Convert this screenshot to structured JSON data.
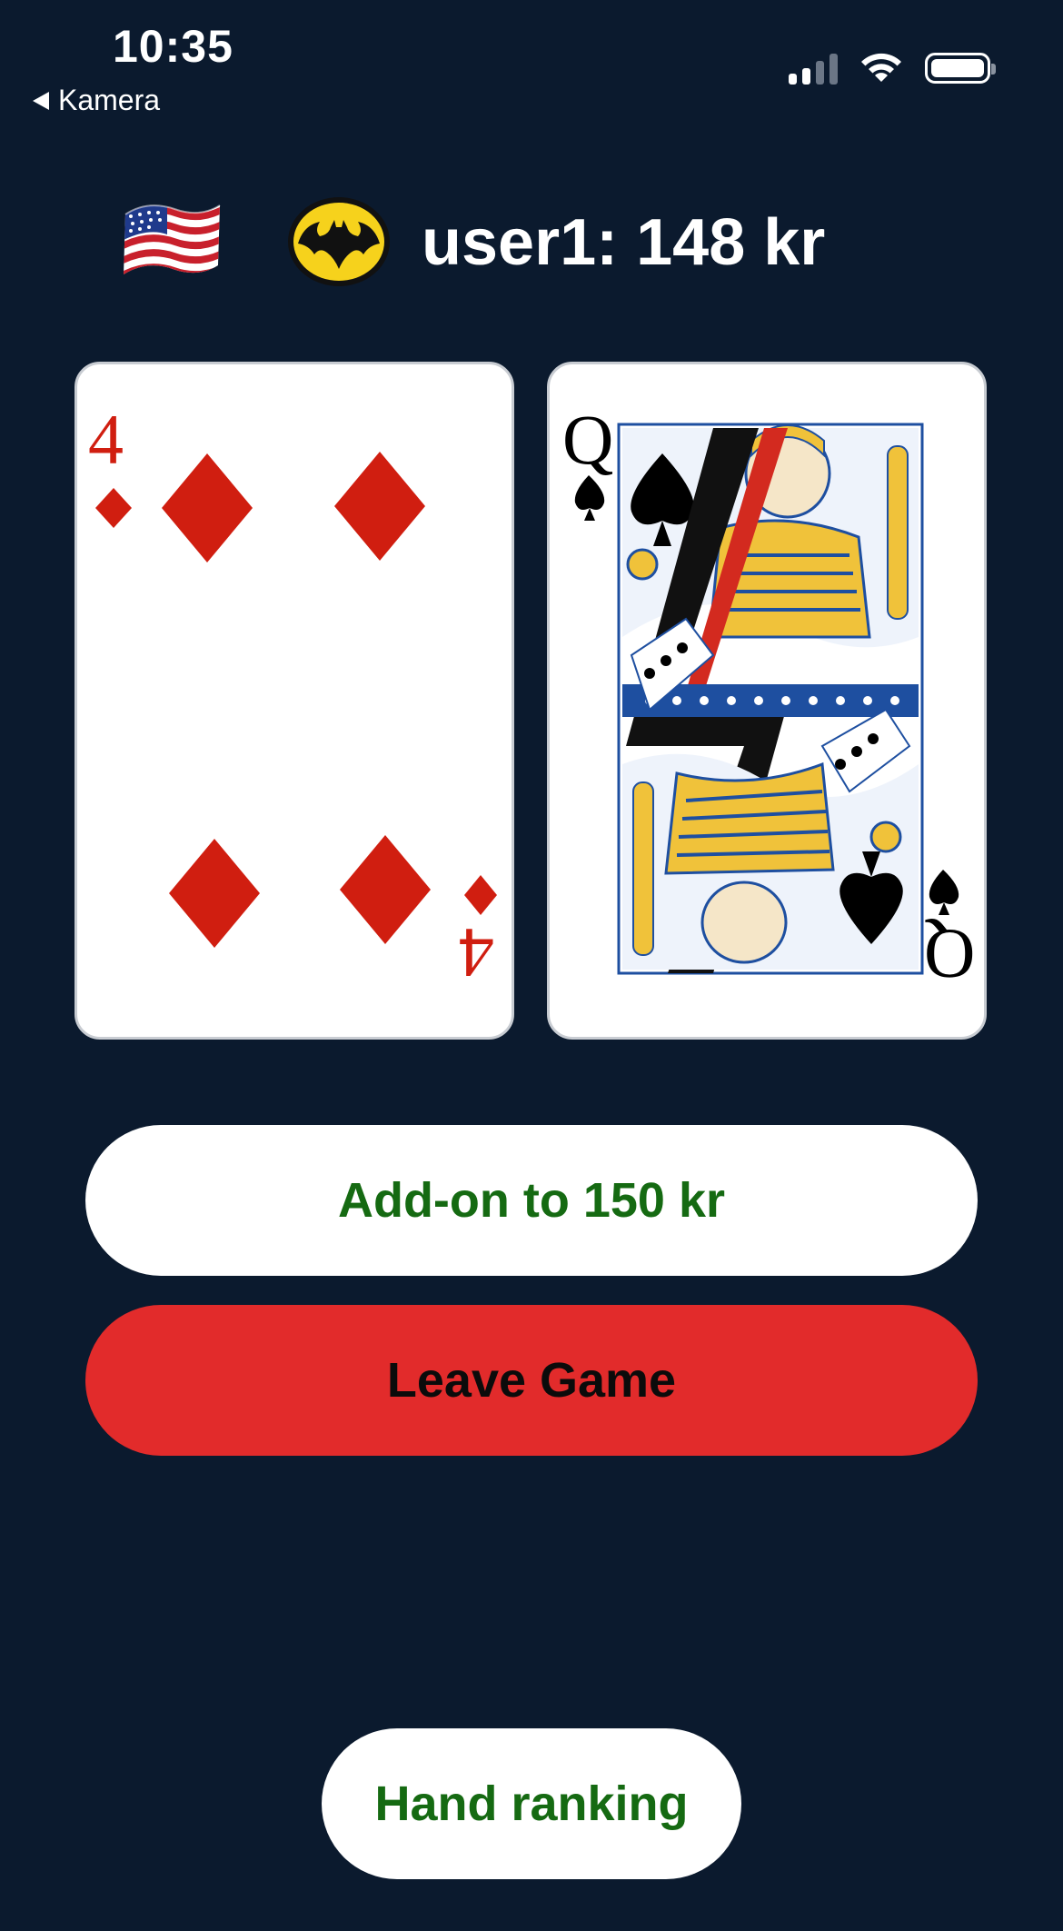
{
  "status_bar": {
    "time": "10:35",
    "back_label": "Kamera",
    "icons": [
      "signal-icon",
      "wifi-icon",
      "battery-icon"
    ]
  },
  "player": {
    "flag": "us-flag-icon",
    "avatar": "batman-icon",
    "label": "user1: 148 kr"
  },
  "cards": [
    {
      "rank": "4",
      "suit": "diamonds",
      "color": "#d01e10"
    },
    {
      "rank": "Q",
      "suit": "spades",
      "color": "#000000"
    }
  ],
  "buttons": {
    "addon": "Add-on to 150 kr",
    "leave": "Leave Game",
    "hand_ranking": "Hand ranking"
  },
  "colors": {
    "background": "#0b1a2e",
    "primary_green": "#156a12",
    "leave_red": "#e22b2b"
  }
}
